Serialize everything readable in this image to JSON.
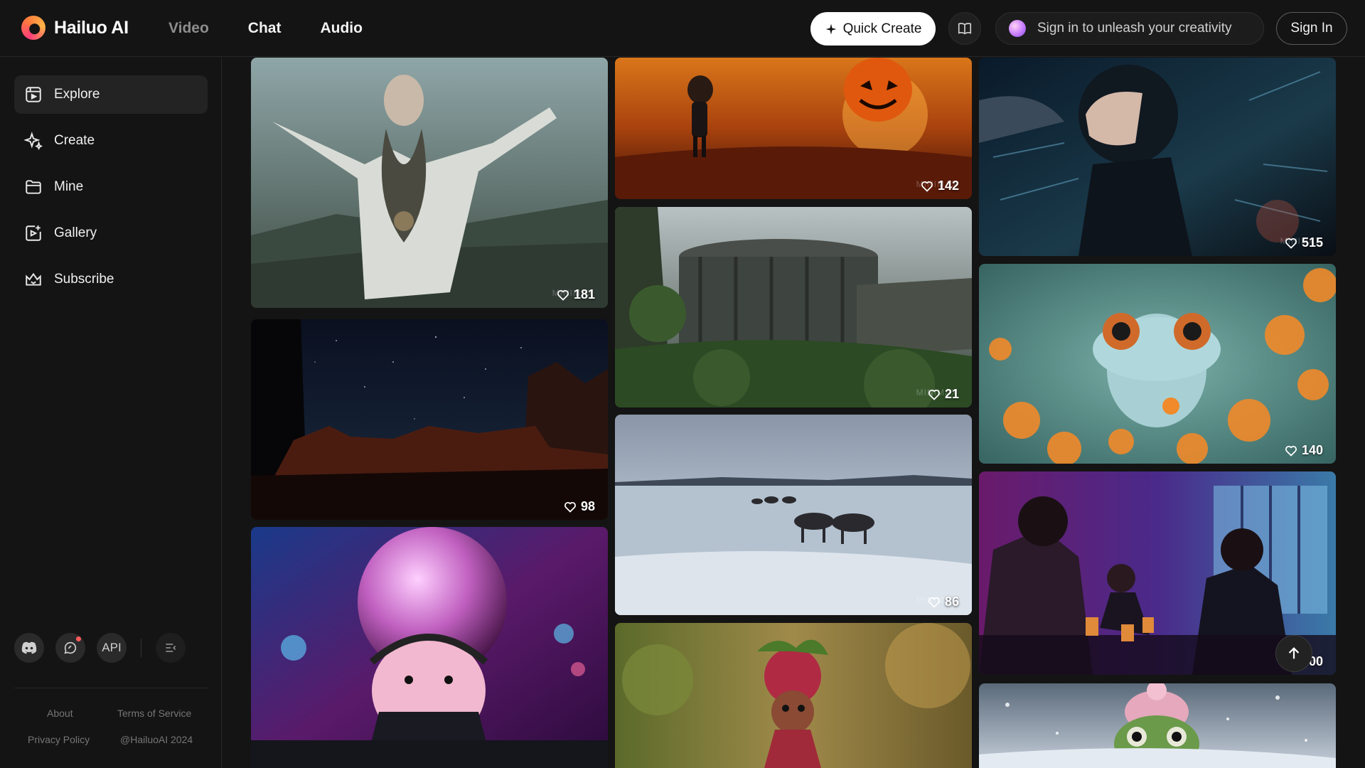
{
  "brand": {
    "name": "Hailuo AI"
  },
  "nav": {
    "video": "Video",
    "chat": "Chat",
    "audio": "Audio"
  },
  "header": {
    "quick_create": "Quick Create",
    "promo_text": "Sign in to unleash your creativity",
    "sign_in": "Sign In"
  },
  "sidebar": {
    "items": [
      {
        "label": "Explore",
        "icon": "explore-icon",
        "active": true
      },
      {
        "label": "Create",
        "icon": "sparkle-icon"
      },
      {
        "label": "Mine",
        "icon": "folder-icon"
      },
      {
        "label": "Gallery",
        "icon": "gallery-icon"
      },
      {
        "label": "Subscribe",
        "icon": "crown-icon"
      }
    ],
    "api_label": "API",
    "footer": {
      "about": "About",
      "terms": "Terms of Service",
      "privacy": "Privacy Policy",
      "copyright": "@HailuoAI 2024"
    }
  },
  "gallery": {
    "cards": [
      {
        "id": "woman-ritual",
        "likes": "181"
      },
      {
        "id": "desert-night",
        "likes": "98"
      },
      {
        "id": "disco-hamster",
        "likes": ""
      },
      {
        "id": "pumpkin-boy",
        "likes": "142"
      },
      {
        "id": "ruined-building",
        "likes": "21"
      },
      {
        "id": "reindeer-ice",
        "likes": "86"
      },
      {
        "id": "berry-doll",
        "likes": ""
      },
      {
        "id": "space-helmet",
        "likes": "515"
      },
      {
        "id": "blue-frog",
        "likes": "140"
      },
      {
        "id": "neon-bar",
        "likes": "00"
      },
      {
        "id": "frog-hat",
        "likes": ""
      }
    ]
  },
  "colors": {
    "background": "#141414",
    "accent": "#ff5a5a"
  }
}
